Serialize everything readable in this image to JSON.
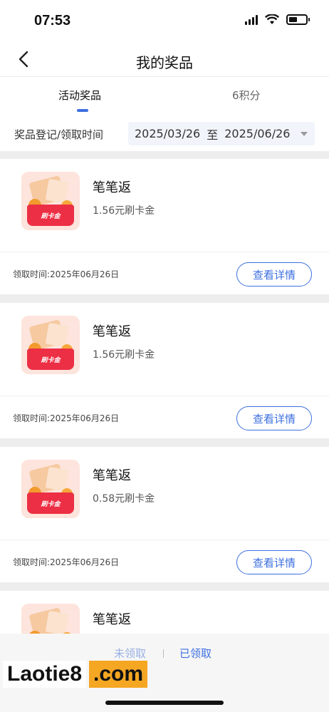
{
  "status_bar": {
    "time": "07:53"
  },
  "nav": {
    "title": "我的奖品"
  },
  "tabs": [
    {
      "label": "活动奖品",
      "active": true
    },
    {
      "label": "6积分",
      "active": false
    }
  ],
  "filter": {
    "label": "奖品登记/领取时间",
    "start_date": "2025/03/26",
    "separator": "至",
    "end_date": "2025/06/26"
  },
  "prizes": [
    {
      "name": "笔笔返",
      "value": "1.56元刷卡金",
      "badge": "刷卡金",
      "claim_time": "领取时间:2025年06月26日",
      "button": "查看详情"
    },
    {
      "name": "笔笔返",
      "value": "1.56元刷卡金",
      "badge": "刷卡金",
      "claim_time": "领取时间:2025年06月26日",
      "button": "查看详情"
    },
    {
      "name": "笔笔返",
      "value": "0.58元刷卡金",
      "badge": "刷卡金",
      "claim_time": "领取时间:2025年06月26日",
      "button": "查看详情"
    },
    {
      "name": "笔笔返"
    }
  ],
  "bottom_tabs": {
    "unclaimed": "未领取",
    "claimed": "已领取"
  },
  "watermark": {
    "left": "Laotie8",
    "right": ".com"
  },
  "colors": {
    "accent": "#3d6fe0",
    "bag": "#ec2f44"
  }
}
